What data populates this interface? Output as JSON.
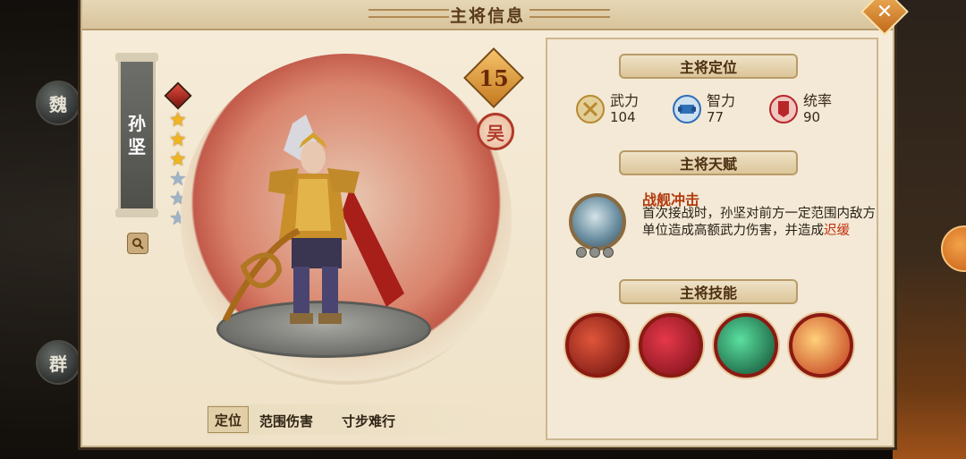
{
  "window": {
    "title": "主将信息"
  },
  "sidebar_factions": [
    "魏",
    "群"
  ],
  "general": {
    "name": "孙坚",
    "name_chars": [
      "孙",
      "坚"
    ],
    "level": "15",
    "faction": "吴",
    "stars_total": 6,
    "stars_filled": 3,
    "position_label": "定位",
    "tags": [
      "范围伤害",
      "寸步难行"
    ]
  },
  "sections": {
    "role_header": "主将定位",
    "talent_header": "主将天赋",
    "skills_header": "主将技能"
  },
  "stats": [
    {
      "label": "武力",
      "value": "104",
      "icon": "crossed-swords-icon",
      "color": "#b8892f"
    },
    {
      "label": "智力",
      "value": "77",
      "icon": "scroll-icon",
      "color": "#2f6fb8"
    },
    {
      "label": "统率",
      "value": "90",
      "icon": "banner-icon",
      "color": "#b8262a"
    }
  ],
  "talent": {
    "name": "战舰冲击",
    "desc_main": "首次接战时，孙坚对前方一定范围内敌方单位造成高额武力伤害，并造成",
    "desc_highlight": "迟缓"
  },
  "skills": [
    {
      "icon": "red-fortress-skill-icon",
      "color": "#b0281e"
    },
    {
      "icon": "red-banner-skill-icon",
      "color": "#c0202a"
    },
    {
      "icon": "green-wind-skill-icon",
      "color": "#1f8a5a"
    },
    {
      "icon": "fire-spear-skill-icon",
      "color": "#d8522a"
    }
  ],
  "colors": {
    "accent": "#c57a1f",
    "panel": "#f6ecd9",
    "highlight": "#c2300e"
  }
}
